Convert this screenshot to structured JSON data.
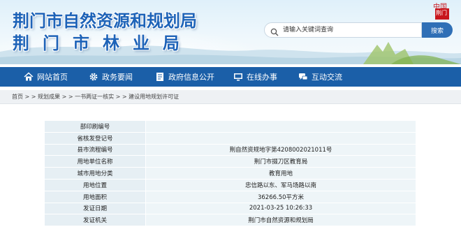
{
  "header": {
    "title_line1": "荆门市自然资源和规划局",
    "title_line2": "荆门市林业局",
    "logo_top": "中国",
    "logo_bottom": "荆门"
  },
  "search": {
    "placeholder": "请输入关键词查询",
    "button_label": "搜索"
  },
  "nav": {
    "items": [
      {
        "label": "网站首页",
        "icon": "home-icon"
      },
      {
        "label": "政务要闻",
        "icon": "gear-icon"
      },
      {
        "label": "政府信息公开",
        "icon": "document-icon"
      },
      {
        "label": "在线办事",
        "icon": "monitor-icon"
      },
      {
        "label": "互动交流",
        "icon": "chat-icon"
      }
    ]
  },
  "breadcrumb": {
    "text": "首页 > > 规划成果 > > 一书两证一核实 > > 建设用地规划许可证"
  },
  "detail_table": {
    "rows": [
      {
        "label": "部印刷编号",
        "value": ""
      },
      {
        "label": "省核发登记号",
        "value": ""
      },
      {
        "label": "县市流程编号",
        "value": "荆自然资规地字第4208002021011号"
      },
      {
        "label": "用地单位名称",
        "value": "荆门市掇刀区教育局"
      },
      {
        "label": "城市用地分类",
        "value": "教育用地"
      },
      {
        "label": "用地位置",
        "value": "忠信路以东、军马场路以南"
      },
      {
        "label": "用地面积",
        "value": "36266.50平方米"
      },
      {
        "label": "发证日期",
        "value": "2021-03-25 10:26:33"
      },
      {
        "label": "发证机关",
        "value": "荆门市自然资源和规划局"
      }
    ]
  },
  "colors": {
    "title": "#1e63b8",
    "nav_bg": "#1b5fa8",
    "search_button": "#2f6fb6",
    "table_label_bg": "#e6eff4",
    "table_value_bg": "#eef5f8",
    "logo_red": "#c8161d"
  }
}
